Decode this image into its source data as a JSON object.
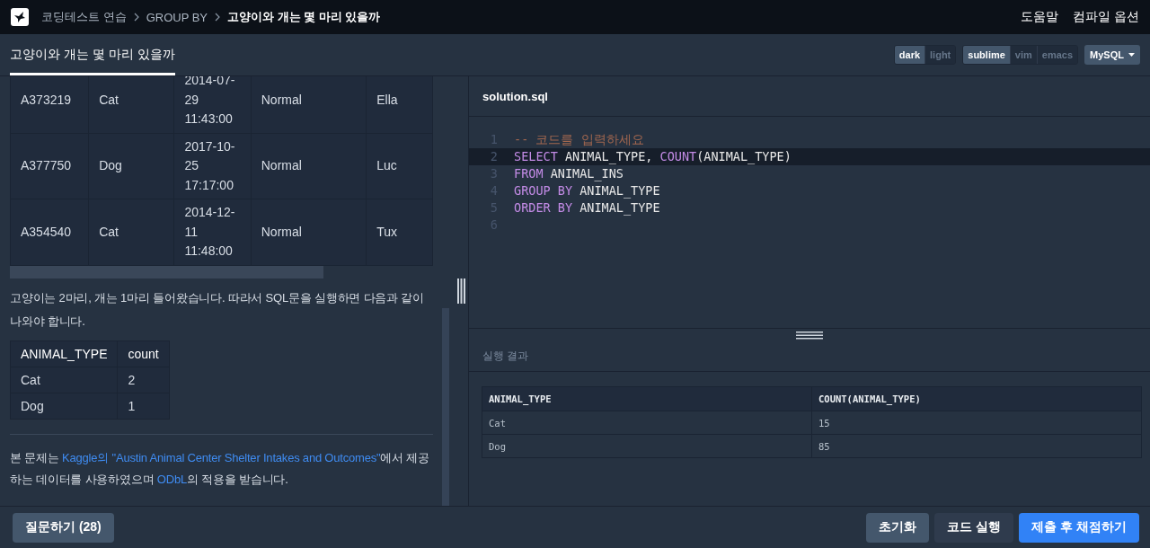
{
  "nav": {
    "breadcrumbs": [
      {
        "label": "코딩테스트 연습",
        "current": false
      },
      {
        "label": "GROUP BY",
        "current": false
      },
      {
        "label": "고양이와 개는 몇 마리 있을까",
        "current": true
      }
    ],
    "links": [
      "도움말",
      "컴파일 옵션"
    ]
  },
  "tabs": [
    {
      "label": "고양이와 개는 몇 마리 있을까",
      "selected": true
    }
  ],
  "theme_toggle": [
    {
      "label": "dark",
      "selected": true
    },
    {
      "label": "light",
      "selected": false
    }
  ],
  "keymap_toggle": [
    {
      "label": "sublime",
      "selected": true
    },
    {
      "label": "vim",
      "selected": false
    },
    {
      "label": "emacs",
      "selected": false
    }
  ],
  "language_dropdown": {
    "value": "MySQL"
  },
  "problem": {
    "data_table": {
      "rows": [
        [
          "A373219",
          "Cat",
          "2014-07-29 11:43:00",
          "Normal",
          "Ella"
        ],
        [
          "A377750",
          "Dog",
          "2017-10-25 17:17:00",
          "Normal",
          "Luc"
        ],
        [
          "A354540",
          "Cat",
          "2014-12-11 11:48:00",
          "Normal",
          "Tux"
        ]
      ]
    },
    "description": "고양이는 2마리, 개는 1마리 들어왔습니다. 따라서 SQL문을 실행하면 다음과 같이 나와야 합니다.",
    "example_table": {
      "columns": [
        "ANIMAL_TYPE",
        "count"
      ],
      "rows": [
        [
          "Cat",
          "2"
        ],
        [
          "Dog",
          "1"
        ]
      ]
    },
    "source": [
      {
        "text": "본 문제는 ",
        "kind": "text"
      },
      {
        "text": "Kaggle의 \"Austin Animal Center Shelter Intakes and Outcomes\"",
        "kind": "link"
      },
      {
        "text": "에서 제공하는 데이터를 사용하였으며 ",
        "kind": "text"
      },
      {
        "text": "ODbL",
        "kind": "link"
      },
      {
        "text": "의 적용을 받습니다.",
        "kind": "text"
      }
    ]
  },
  "editor": {
    "filename": "solution.sql",
    "lines": [
      {
        "number": "1",
        "active": false,
        "tokens": [
          {
            "text": "-- 코드를 입력하세요",
            "kind": "comment"
          }
        ]
      },
      {
        "number": "2",
        "active": true,
        "tokens": [
          {
            "text": "SELECT",
            "kind": "keyword"
          },
          {
            "text": " ANIMAL_TYPE, ",
            "kind": "plain"
          },
          {
            "text": "COUNT",
            "kind": "keyword"
          },
          {
            "text": "(ANIMAL_TYPE)",
            "kind": "plain"
          }
        ]
      },
      {
        "number": "3",
        "active": false,
        "tokens": [
          {
            "text": "FROM",
            "kind": "keyword"
          },
          {
            "text": " ANIMAL_INS",
            "kind": "plain"
          }
        ]
      },
      {
        "number": "4",
        "active": false,
        "tokens": [
          {
            "text": "GROUP BY",
            "kind": "keyword"
          },
          {
            "text": " ANIMAL_TYPE",
            "kind": "plain"
          }
        ]
      },
      {
        "number": "5",
        "active": false,
        "tokens": [
          {
            "text": "ORDER BY",
            "kind": "keyword"
          },
          {
            "text": " ANIMAL_TYPE",
            "kind": "plain"
          }
        ]
      },
      {
        "number": "6",
        "active": false
      }
    ]
  },
  "result": {
    "title": "실행 결과",
    "columns": [
      "ANIMAL_TYPE",
      "COUNT(ANIMAL_TYPE)"
    ],
    "rows": [
      [
        "Cat",
        "15"
      ],
      [
        "Dog",
        "85"
      ]
    ]
  },
  "footer": {
    "question_button": "질문하기 (28)",
    "buttons": [
      {
        "label": "초기화",
        "kind": "secondary"
      },
      {
        "label": "코드 실행",
        "kind": "dark"
      },
      {
        "label": "제출 후 채점하기",
        "kind": "primary"
      }
    ]
  }
}
